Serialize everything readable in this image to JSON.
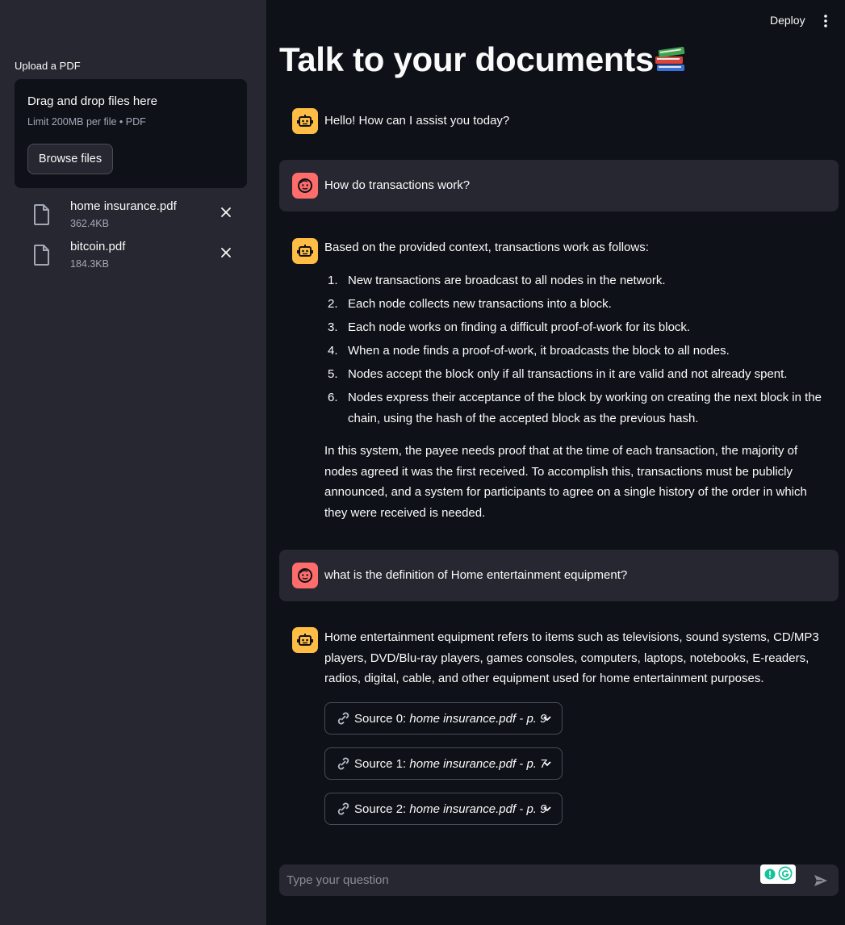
{
  "sidebar": {
    "upload_label": "Upload a PDF",
    "dropzone": {
      "title": "Drag and drop files here",
      "subtitle": "Limit 200MB per file • PDF",
      "browse_label": "Browse files"
    },
    "files": [
      {
        "name": "home insurance.pdf",
        "size": "362.4KB"
      },
      {
        "name": "bitcoin.pdf",
        "size": "184.3KB"
      }
    ]
  },
  "header": {
    "deploy_label": "Deploy"
  },
  "page": {
    "title": "Talk to your documents",
    "title_emoji": "books-icon"
  },
  "chat": {
    "msg1": "Hello! How can I assist you today?",
    "msg2": "How do transactions work?",
    "msg3_intro": "Based on the provided context, transactions work as follows:",
    "msg3_steps": [
      {
        "num": "1.",
        "text": "New transactions are broadcast to all nodes in the network."
      },
      {
        "num": "2.",
        "text": "Each node collects new transactions into a block."
      },
      {
        "num": "3.",
        "text": "Each node works on finding a difficult proof-of-work for its block."
      },
      {
        "num": "4.",
        "text": "When a node finds a proof-of-work, it broadcasts the block to all nodes."
      },
      {
        "num": "5.",
        "text": "Nodes accept the block only if all transactions in it are valid and not already spent."
      },
      {
        "num": "6.",
        "text": "Nodes express their acceptance of the block by working on creating the next block in the chain, using the hash of the accepted block as the previous hash."
      }
    ],
    "msg3_outro": "In this system, the payee needs proof that at the time of each transaction, the majority of nodes agreed it was the first received. To accomplish this, transactions must be publicly announced, and a system for participants to agree on a single history of the order in which they were received is needed.",
    "msg4": "what is the definition of Home entertainment equipment?",
    "msg5": "Home entertainment equipment refers to items such as televisions, sound systems, CD/MP3 players, DVD/Blu-ray players, games consoles, computers, laptops, notebooks, E-readers, radios, digital, cable, and other equipment used for home entertainment purposes.",
    "sources": [
      {
        "prefix": "Source 0: ",
        "doc": "home insurance.pdf - p. 9"
      },
      {
        "prefix": "Source 1: ",
        "doc": "home insurance.pdf - p. 7"
      },
      {
        "prefix": "Source 2: ",
        "doc": "home insurance.pdf - p. 9"
      }
    ]
  },
  "input": {
    "placeholder": "Type your question"
  },
  "colors": {
    "background": "#0e1117",
    "sidebar": "#262730",
    "bot_avatar": "#ffbd45",
    "user_avatar": "#ff6c6c"
  }
}
